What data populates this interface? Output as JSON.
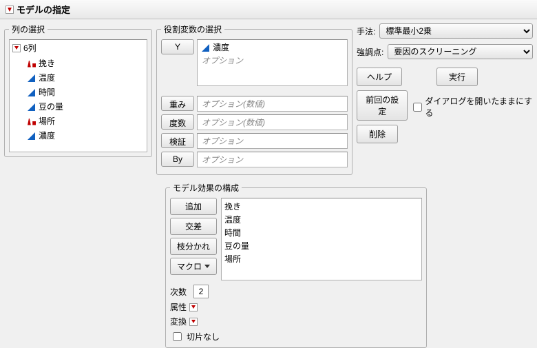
{
  "title": "モデルの指定",
  "columns": {
    "legend": "列の選択",
    "root_label": "6列",
    "items": [
      {
        "name": "挽き",
        "icon": "nominal"
      },
      {
        "name": "温度",
        "icon": "continuous"
      },
      {
        "name": "時間",
        "icon": "continuous"
      },
      {
        "name": "豆の量",
        "icon": "continuous"
      },
      {
        "name": "場所",
        "icon": "nominal"
      },
      {
        "name": "濃度",
        "icon": "continuous"
      }
    ]
  },
  "roles": {
    "legend": "役割変数の選択",
    "y_label": "Y",
    "y_value": "濃度",
    "y_placeholder": "オプション",
    "weight_label": "重み",
    "weight_placeholder": "オプション(数値)",
    "freq_label": "度数",
    "freq_placeholder": "オプション(数値)",
    "valid_label": "検証",
    "valid_placeholder": "オプション",
    "by_label": "By",
    "by_placeholder": "オプション"
  },
  "right": {
    "method_label": "手法:",
    "method_value": "標準最小2乗",
    "emphasis_label": "強調点:",
    "emphasis_value": "要因のスクリーニング",
    "help": "ヘルプ",
    "run": "実行",
    "recall": "前回の設定",
    "keep_open": "ダイアログを開いたままにする",
    "delete": "削除"
  },
  "effects": {
    "legend": "モデル効果の構成",
    "add": "追加",
    "cross": "交差",
    "nest": "枝分かれ",
    "macro": "マクロ",
    "degree_label": "次数",
    "degree_value": "2",
    "attr_label": "属性",
    "trans_label": "変換",
    "no_intercept": "切片なし",
    "items": [
      "挽き",
      "温度",
      "時間",
      "豆の量",
      "場所"
    ]
  }
}
